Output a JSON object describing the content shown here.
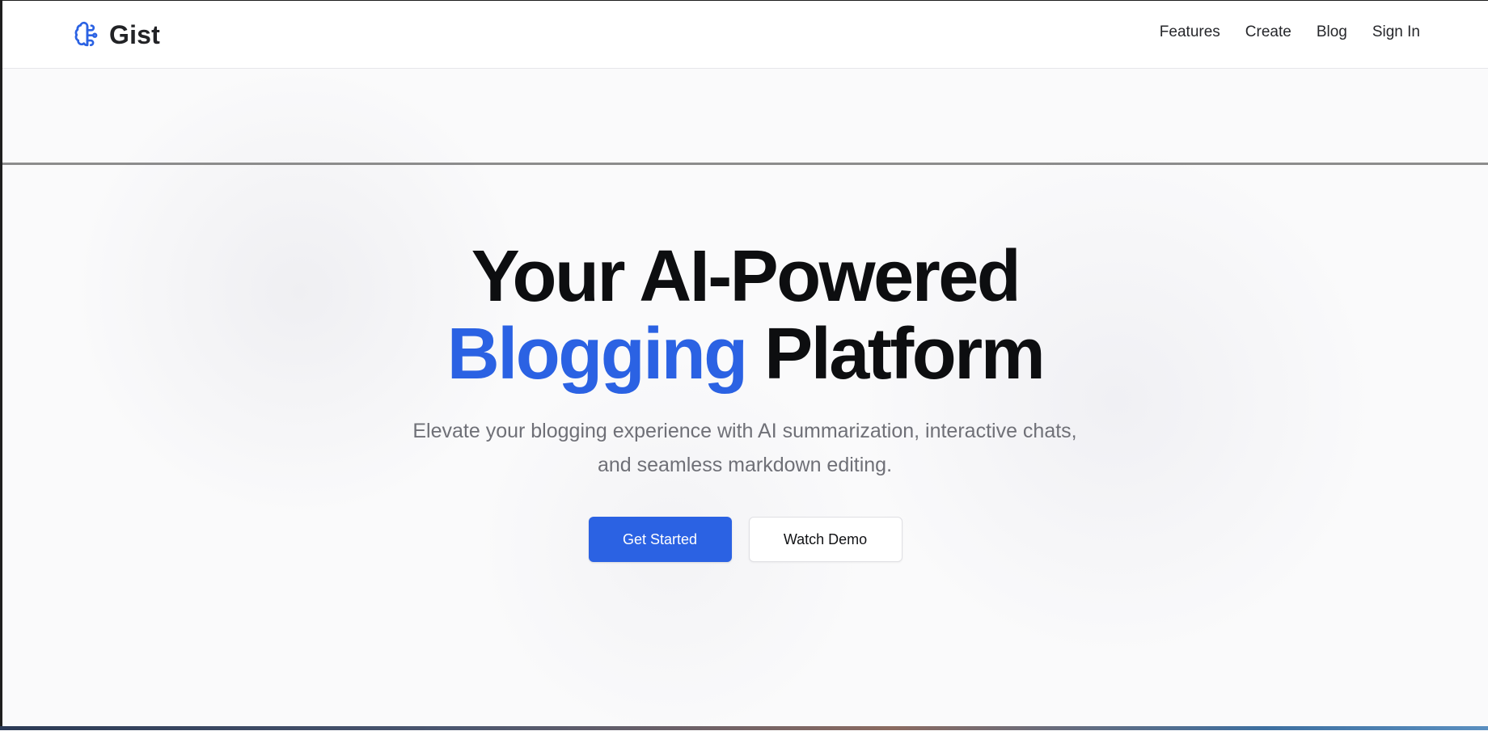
{
  "header": {
    "brand": {
      "name": "Gist",
      "icon": "brain-icon",
      "icon_color": "#2b62e3"
    },
    "nav": [
      {
        "label": "Features"
      },
      {
        "label": "Create"
      },
      {
        "label": "Blog"
      },
      {
        "label": "Sign In"
      }
    ]
  },
  "hero": {
    "title_line1": "Your AI-Powered",
    "title_accent": "Blogging",
    "title_rest": " Platform",
    "subtitle_line1": "Elevate your blogging experience with AI summarization, interactive chats,",
    "subtitle_line2": "and seamless markdown editing.",
    "primary_cta": "Get Started",
    "secondary_cta": "Watch Demo"
  },
  "colors": {
    "accent": "#2b62e3",
    "text": "#0d0e10",
    "muted": "#6f7077"
  }
}
